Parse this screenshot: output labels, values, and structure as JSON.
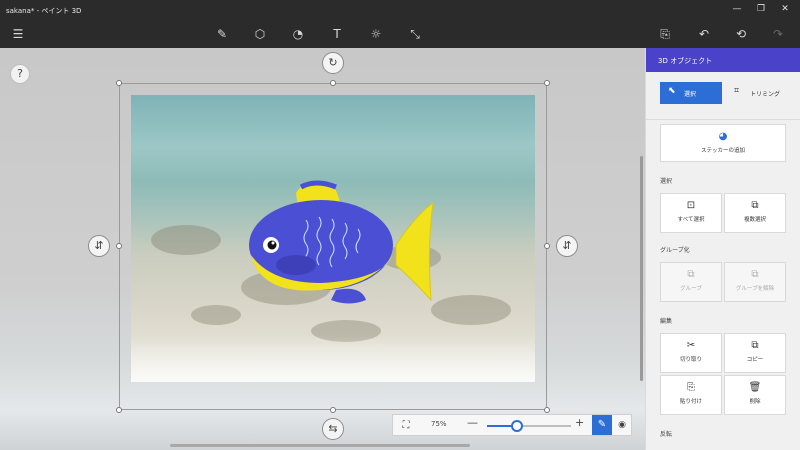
{
  "window": {
    "title": "sakana* - ペイント 3D",
    "controls": {
      "minimize": "—",
      "restore": "❐",
      "close": "✕"
    }
  },
  "toolbar": {
    "menu_icon": "☰",
    "tools": [
      {
        "name": "brush-icon",
        "glyph": "✎"
      },
      {
        "name": "3d-shapes-icon",
        "glyph": "⬡"
      },
      {
        "name": "stickers-icon",
        "glyph": "◔"
      },
      {
        "name": "text-icon",
        "glyph": "T"
      },
      {
        "name": "effects-icon",
        "glyph": "☼"
      },
      {
        "name": "canvas-icon",
        "glyph": "⤡"
      }
    ],
    "paste_icon": "⎘",
    "undo_icon": "↶",
    "history_icon": "⟲",
    "redo_icon": "↷"
  },
  "canvas": {
    "help_label": "?",
    "rotate_icon": "↻",
    "left_ctrl_icon": "⇵",
    "right_ctrl_icon": "⇵",
    "bottom_ctrl_icon": "⇆"
  },
  "zoom": {
    "fit_icon": "⛶",
    "percent_label": "75%",
    "minus": "—",
    "plus": "+",
    "fraction": 0.36,
    "pen_icon": "✎",
    "view_icon": "◉"
  },
  "panel": {
    "header": "3D オブジェクト",
    "mode_select": {
      "icon": "⬉",
      "label": "選択"
    },
    "mode_trim": {
      "icon": "⌗",
      "label": "トリミング"
    },
    "sticker": {
      "icon": "◕",
      "label": "ステッカーの追加"
    },
    "sections": {
      "select": "選択",
      "group": "グループ化",
      "edit": "編集",
      "flip": "反転"
    },
    "select_all": {
      "icon": "⊡",
      "label": "すべて選択"
    },
    "multi_select": {
      "icon": "⧉",
      "label": "複数選択"
    },
    "group": {
      "icon": "⧉",
      "label": "グループ"
    },
    "ungroup": {
      "icon": "⧉",
      "label": "グループを解除"
    },
    "cut": {
      "icon": "✂",
      "label": "切り取り"
    },
    "copy": {
      "icon": "⧉",
      "label": "コピー"
    },
    "paste": {
      "icon": "⎘",
      "label": "貼り付け"
    },
    "delete": {
      "icon": "🗑",
      "label": "削除"
    }
  },
  "colors": {
    "accent": "#2d6ed6",
    "panel_header": "#4a43c9",
    "fish_body": "#4b4fd4",
    "fish_yellow": "#f2e21c"
  }
}
